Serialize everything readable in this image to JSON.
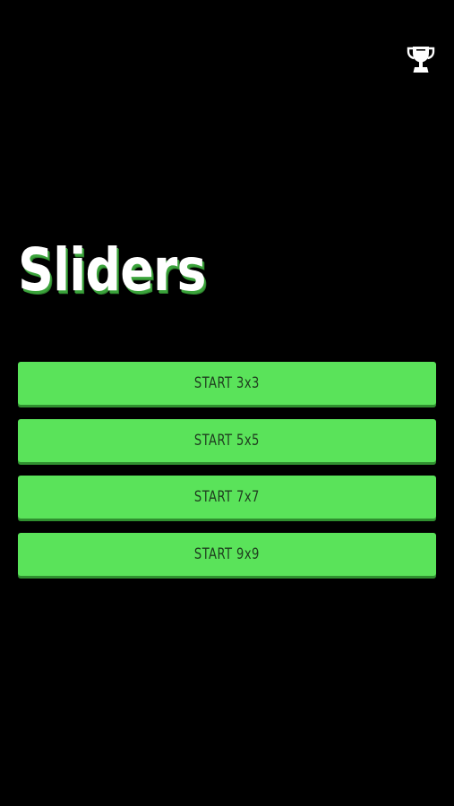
{
  "title": "Sliders",
  "leaderboard": {
    "icon": "trophy-icon"
  },
  "menu": {
    "buttons": [
      {
        "label": "START 3x3"
      },
      {
        "label": "START 5x5"
      },
      {
        "label": "START 7x7"
      },
      {
        "label": "START 9x9"
      }
    ]
  },
  "colors": {
    "background": "#000000",
    "button": "#5ae35a",
    "button_shadow": "#2f8f2f",
    "button_text": "#1f3d1f",
    "title": "#ffffff",
    "title_shadow": "#3aa33a",
    "icon": "#ffffff"
  }
}
